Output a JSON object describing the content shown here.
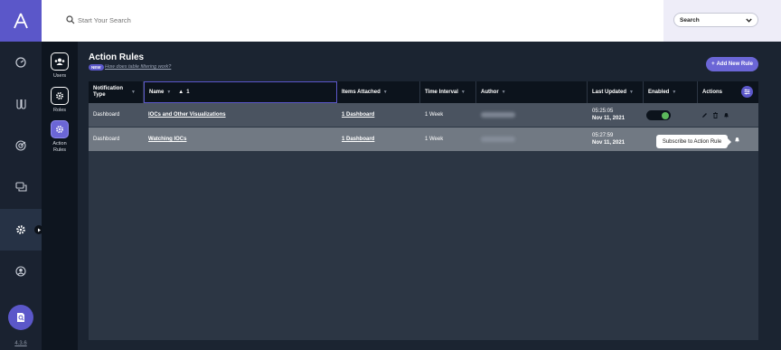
{
  "app": {
    "logo_letter": "A",
    "version": "4.3.6"
  },
  "search": {
    "placeholder": "Start Your Search",
    "scope_value": "Search"
  },
  "rail": {
    "items": [
      {
        "icon": "dashboard-gauge-icon"
      },
      {
        "icon": "flask-icon"
      },
      {
        "icon": "radar-icon"
      },
      {
        "icon": "chat-icon"
      },
      {
        "icon": "gear-icon",
        "active": true
      },
      {
        "icon": "user-circle-icon"
      }
    ],
    "fab_icon": "search-doc-icon"
  },
  "subnav": {
    "items": [
      {
        "label": "Users",
        "icon": "users-icon"
      },
      {
        "label": "Roles",
        "icon": "gear-icon"
      },
      {
        "label_line1": "Action",
        "label_line2": "Rules",
        "icon": "gear-icon",
        "active": true
      }
    ]
  },
  "page": {
    "title": "Action Rules",
    "badge": "NEW",
    "help_link": "How does table filtering work?",
    "add_button": "Add New Rule"
  },
  "table": {
    "columns": {
      "notification_type_1": "Notification",
      "notification_type_2": "Type",
      "name": "Name",
      "name_sort": "1",
      "items_attached": "Items Attached",
      "time_interval": "Time Interval",
      "author": "Author",
      "last_updated": "Last Updated",
      "enabled": "Enabled",
      "actions": "Actions"
    },
    "rows": [
      {
        "notification_type": "Dashboard",
        "name": "IOCs and Other Visualizations",
        "items_attached": "1 Dashboard",
        "time_interval": "1 Week",
        "updated_time": "05:25:05",
        "updated_date": "Nov 11, 2021",
        "enabled": true
      },
      {
        "notification_type": "Dashboard",
        "name": "Watching IOCs",
        "items_attached": "1 Dashboard",
        "time_interval": "1 Week",
        "updated_time": "05:27:59",
        "updated_date": "Nov 11, 2021",
        "tooltip": "Subscribe to Action Rule"
      }
    ]
  },
  "colors": {
    "accent": "#5b57c9",
    "enabled_green": "#5cb85c",
    "panel": "#2c3644"
  }
}
